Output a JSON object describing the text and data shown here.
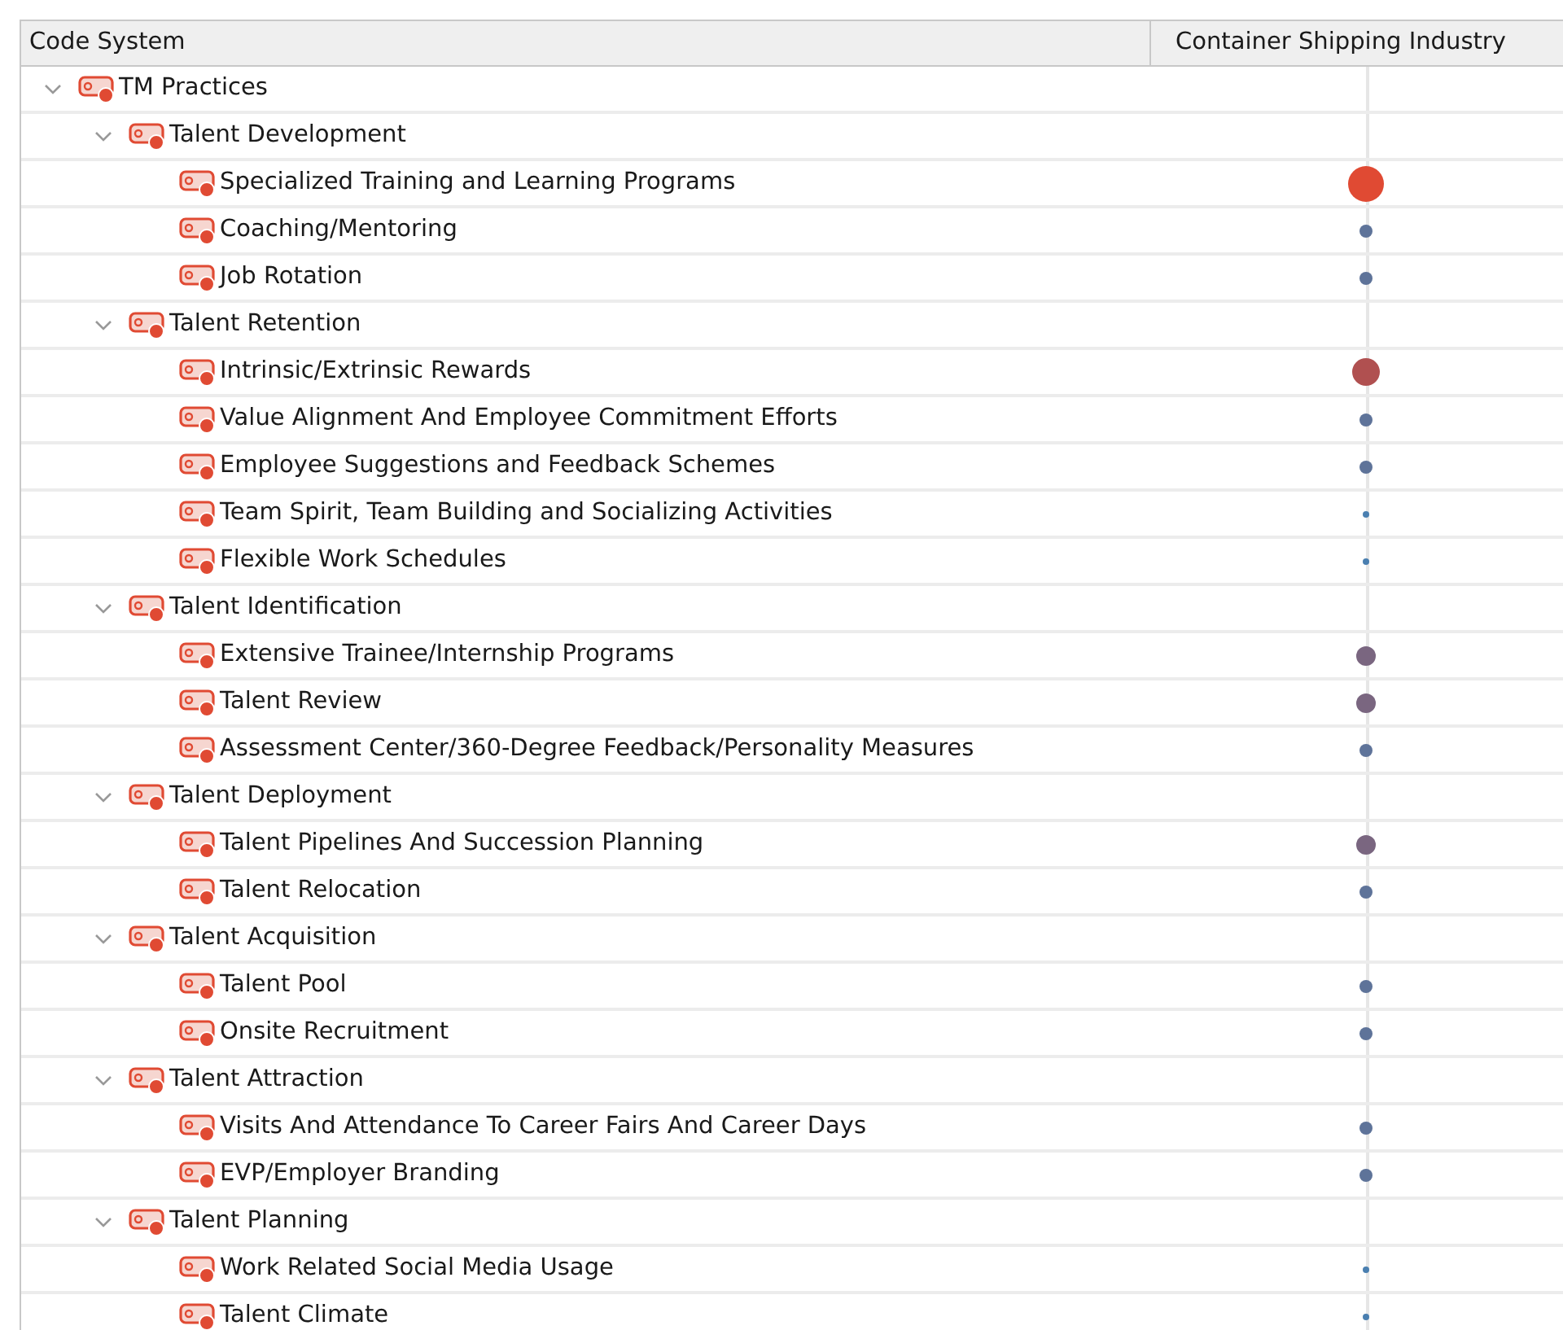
{
  "columns": [
    {
      "label": "Code System"
    },
    {
      "label": "Container Shipping Industry"
    }
  ],
  "tree": [
    {
      "label": "TM Practices",
      "expanded": true,
      "children": [
        {
          "label": "Talent Development",
          "expanded": true,
          "children": [
            {
              "label": "Specialized Training and Learning Programs",
              "dot": {
                "kind": "large",
                "color": "#e04a33"
              }
            },
            {
              "label": "Coaching/Mentoring",
              "dot": {
                "kind": "medium",
                "color": "#5e7399"
              }
            },
            {
              "label": "Job Rotation",
              "dot": {
                "kind": "medium",
                "color": "#5e7399"
              }
            }
          ]
        },
        {
          "label": "Talent Retention",
          "expanded": true,
          "children": [
            {
              "label": "Intrinsic/Extrinsic Rewards",
              "dot": {
                "kind": "big",
                "color": "#b05050"
              }
            },
            {
              "label": "Value Alignment And Employee Commitment Efforts",
              "dot": {
                "kind": "medium",
                "color": "#5e7399"
              }
            },
            {
              "label": "Employee Suggestions and Feedback Schemes",
              "dot": {
                "kind": "medium",
                "color": "#5e7399"
              }
            },
            {
              "label": "Team Spirit, Team Building and Socializing Activities",
              "dot": {
                "kind": "small",
                "color": "#4a7fb0"
              }
            },
            {
              "label": "Flexible Work Schedules",
              "dot": {
                "kind": "small",
                "color": "#4a7fb0"
              }
            }
          ]
        },
        {
          "label": "Talent Identification",
          "expanded": true,
          "children": [
            {
              "label": "Extensive Trainee/Internship Programs",
              "dot": {
                "kind": "mid",
                "color": "#7a6680"
              }
            },
            {
              "label": "Talent Review",
              "dot": {
                "kind": "mid",
                "color": "#7a6680"
              }
            },
            {
              "label": "Assessment Center/360-Degree Feedback/Personality Measures",
              "dot": {
                "kind": "medium",
                "color": "#5e7399"
              }
            }
          ]
        },
        {
          "label": "Talent Deployment",
          "expanded": true,
          "children": [
            {
              "label": "Talent Pipelines And Succession Planning",
              "dot": {
                "kind": "mid",
                "color": "#7a6680"
              }
            },
            {
              "label": "Talent Relocation",
              "dot": {
                "kind": "medium",
                "color": "#5e7399"
              }
            }
          ]
        },
        {
          "label": "Talent Acquisition",
          "expanded": true,
          "children": [
            {
              "label": "Talent Pool",
              "dot": {
                "kind": "medium",
                "color": "#5e7399"
              }
            },
            {
              "label": "Onsite Recruitment",
              "dot": {
                "kind": "medium",
                "color": "#5e7399"
              }
            }
          ]
        },
        {
          "label": "Talent Attraction",
          "expanded": true,
          "children": [
            {
              "label": "Visits And Attendance To Career Fairs And Career Days",
              "dot": {
                "kind": "medium",
                "color": "#5e7399"
              }
            },
            {
              "label": "EVP/Employer Branding",
              "dot": {
                "kind": "medium",
                "color": "#5e7399"
              }
            }
          ]
        },
        {
          "label": "Talent Planning",
          "expanded": true,
          "children": [
            {
              "label": "Work Related Social Media Usage",
              "dot": {
                "kind": "small",
                "color": "#4a7fb0"
              }
            },
            {
              "label": "Talent Climate",
              "dot": {
                "kind": "small",
                "color": "#4a7fb0"
              }
            }
          ]
        }
      ]
    }
  ]
}
